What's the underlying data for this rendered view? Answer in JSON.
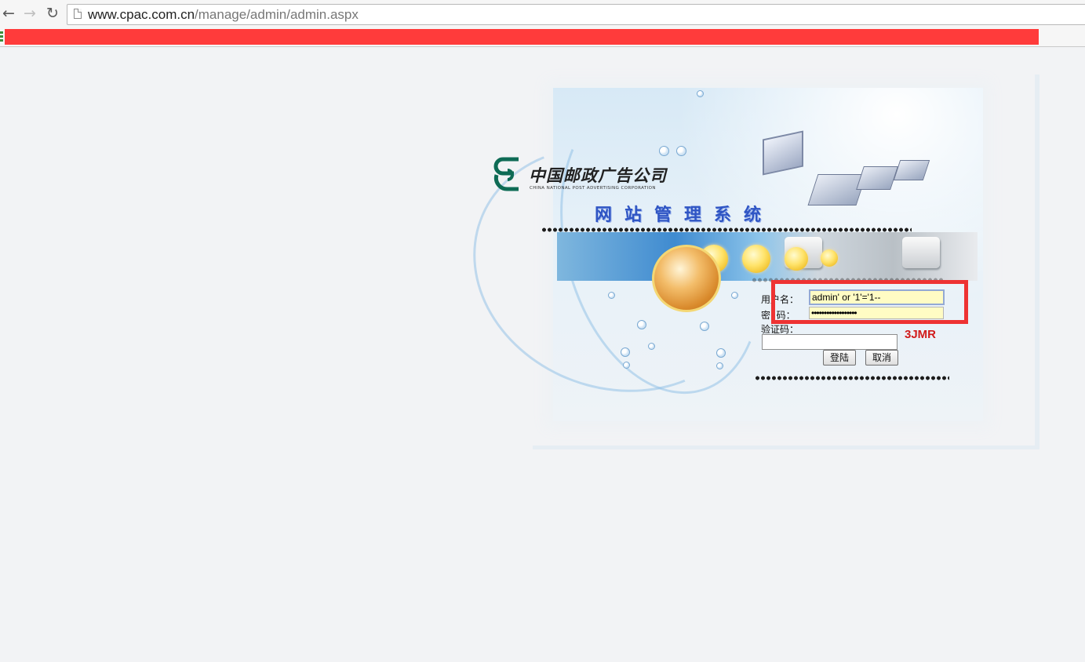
{
  "browser": {
    "back_icon": "←",
    "forward_icon": "→",
    "reload_icon": "↻",
    "url_host": "www.cpac.com.cn",
    "url_path": "/manage/admin/admin.aspx",
    "redaction_color": "#ff3b3b"
  },
  "brand": {
    "name": "中国邮政广告公司",
    "name_en": "CHINA NATIONAL POST ADVERTISING CORPORATION",
    "system_title": "网站管理系统",
    "logo_color": "#0e6b55"
  },
  "form": {
    "username_label": "用户名：",
    "username_value": "admin' or '1'='1--",
    "password_label": "密  码：",
    "password_value": "••••••••••••••••••",
    "captcha_label": "验证码：",
    "captcha_value": "",
    "captcha_code": "3JMR",
    "login_button": "登陆",
    "cancel_button": "取消"
  },
  "annotation": {
    "highlight_color": "#ee3333"
  }
}
